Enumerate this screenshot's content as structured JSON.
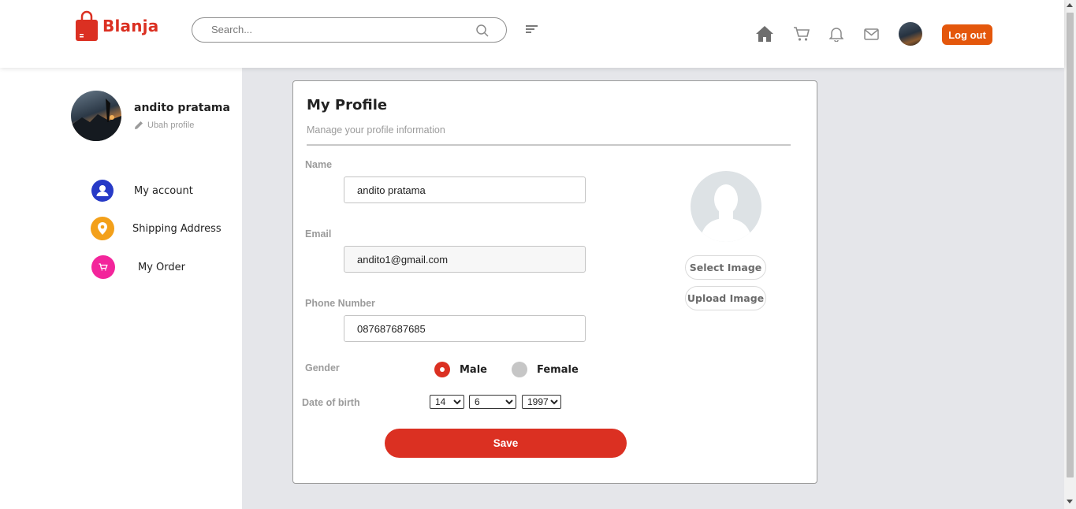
{
  "header": {
    "brand": "Blanja",
    "search_placeholder": "Search...",
    "logout_label": "Log out",
    "brand_color": "#db3022",
    "logout_color": "#e4570c",
    "icons": [
      "search-icon",
      "filter-icon",
      "home-icon",
      "cart-icon",
      "bell-icon",
      "mail-icon"
    ]
  },
  "sidebar": {
    "user_name": "andito pratama",
    "edit_label": "Ubah profile",
    "items": [
      {
        "label": "My account",
        "icon": "user-icon",
        "color": "#273ac7"
      },
      {
        "label": "Shipping Address",
        "icon": "location-pin-icon",
        "color": "#f3a01a"
      },
      {
        "label": "My Order",
        "icon": "cart-icon",
        "color": "#f3259b"
      }
    ]
  },
  "profile": {
    "title": "My Profile",
    "subtitle": "Manage your profile information",
    "name_label": "Name",
    "name_value": "andito pratama",
    "email_label": "Email",
    "email_value": "andito1@gmail.com",
    "phone_label": "Phone Number",
    "phone_value": "087687687685",
    "gender_label": "Gender",
    "gender_male": "Male",
    "gender_female": "Female",
    "gender_selected": "Male",
    "dob_label": "Date of birth",
    "dob_day": "14",
    "dob_month": "6",
    "dob_year": "1997",
    "save_label": "Save",
    "select_image_label": "Select Image",
    "upload_image_label": "Upload Image"
  }
}
